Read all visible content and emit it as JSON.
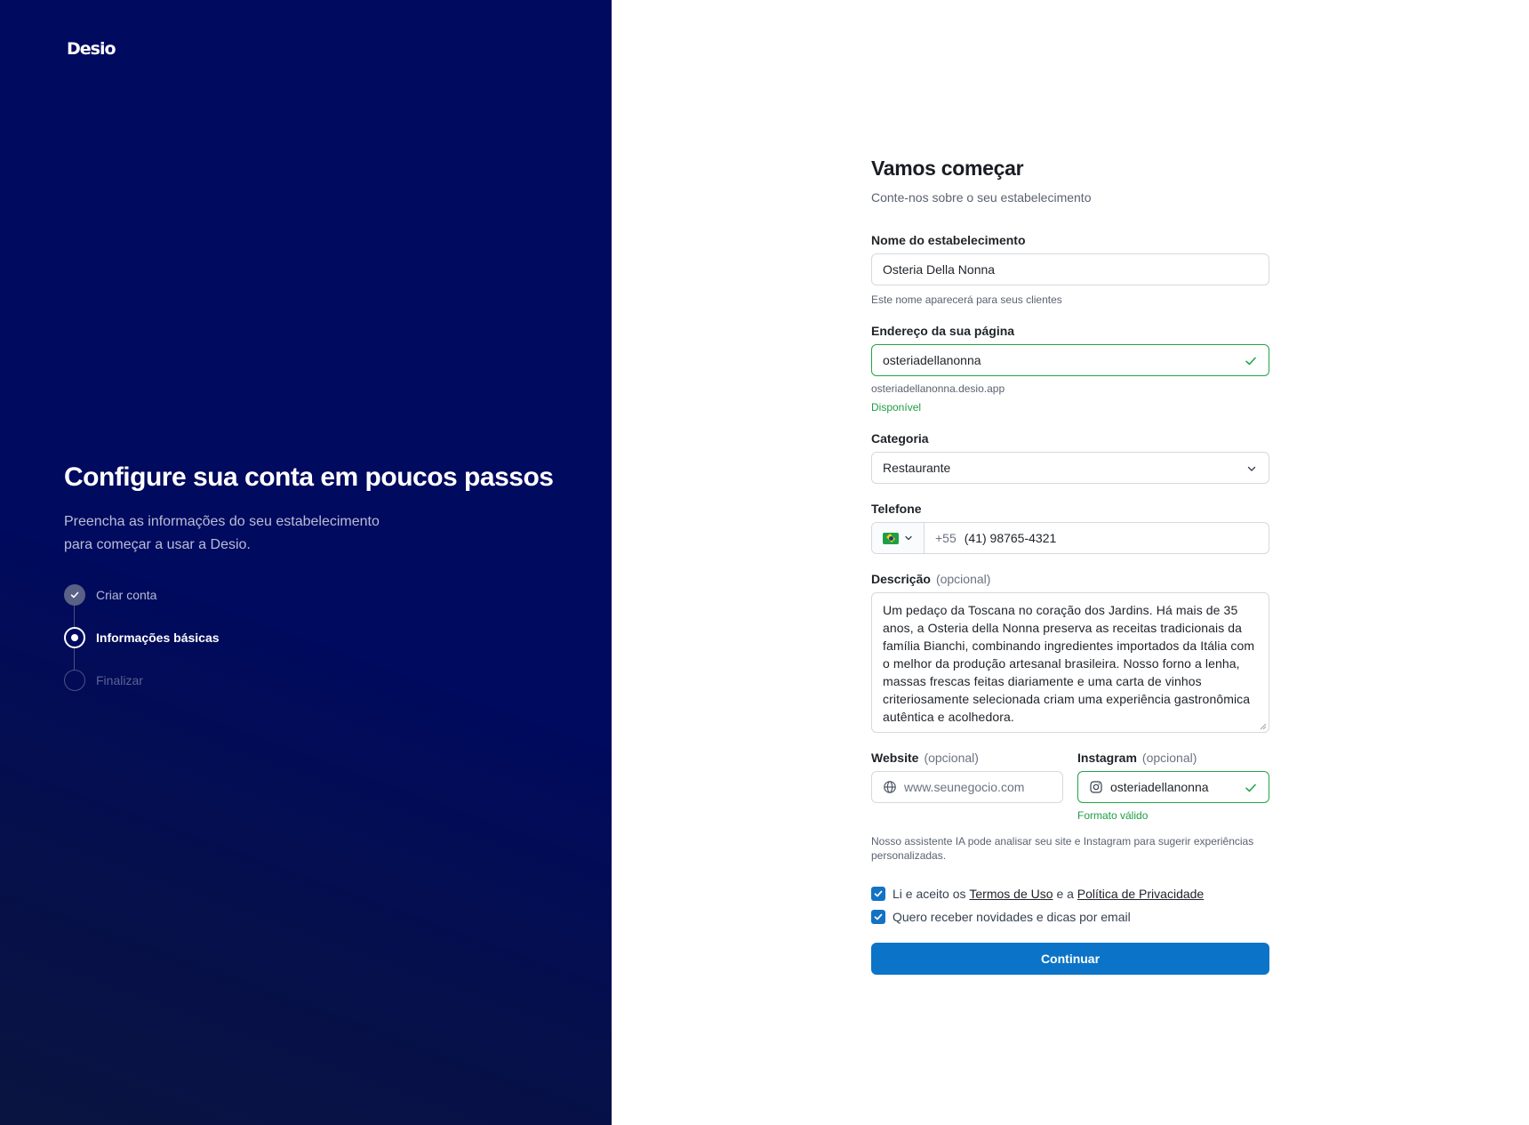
{
  "brand": {
    "name": "Desio"
  },
  "left_panel": {
    "title": "Configure sua conta em poucos passos",
    "subtitle_line1": "Preencha as informações do seu estabelecimento",
    "subtitle_line2": "para começar a usar a Desio.",
    "steps": [
      {
        "label": "Criar conta",
        "state": "done"
      },
      {
        "label": "Informações básicas",
        "state": "current"
      },
      {
        "label": "Finalizar",
        "state": "todo"
      }
    ]
  },
  "form": {
    "title": "Vamos começar",
    "subtitle": "Conte-nos sobre o seu estabelecimento",
    "name": {
      "label": "Nome do estabelecimento",
      "value": "Osteria Della Nonna",
      "hint": "Este nome aparecerá para seus clientes"
    },
    "page_address": {
      "label": "Endereço da sua página",
      "value": "osteriadellanonna",
      "url_hint": "osteriadellanonna.desio.app",
      "status": "Disponível"
    },
    "category": {
      "label": "Categoria",
      "value": "Restaurante"
    },
    "phone": {
      "label": "Telefone",
      "country_code": "+55",
      "value": "(41) 98765-4321"
    },
    "description": {
      "label": "Descrição",
      "optional": "(opcional)",
      "value": "Um pedaço da Toscana no coração dos Jardins. Há mais de 35 anos, a Osteria della Nonna preserva as receitas tradicionais da família Bianchi, combinando ingredientes importados da Itália com o melhor da produção artesanal brasileira. Nosso forno a lenha, massas frescas feitas diariamente e uma carta de vinhos criteriosamente selecionada criam uma experiência gastronômica autêntica e acolhedora."
    },
    "website": {
      "label": "Website",
      "optional": "(opcional)",
      "placeholder": "www.seunegocio.com"
    },
    "instagram": {
      "label": "Instagram",
      "optional": "(opcional)",
      "value": "osteriadellanonna",
      "status": "Formato válido"
    },
    "ai_note": "Nosso assistente IA pode analisar seu site e Instagram para sugerir experiências personalizadas.",
    "terms": {
      "prefix": "Li e aceito os",
      "terms_link": "Termos de Uso",
      "middle": "e a",
      "privacy_link": "Política de Privacidade",
      "checked": true
    },
    "newsletter": {
      "label": "Quero receber novidades e dicas por email",
      "checked": true
    },
    "submit_label": "Continuar"
  },
  "colors": {
    "panel": "#000a5e",
    "accent": "#0b74c8",
    "success": "#22a447"
  }
}
